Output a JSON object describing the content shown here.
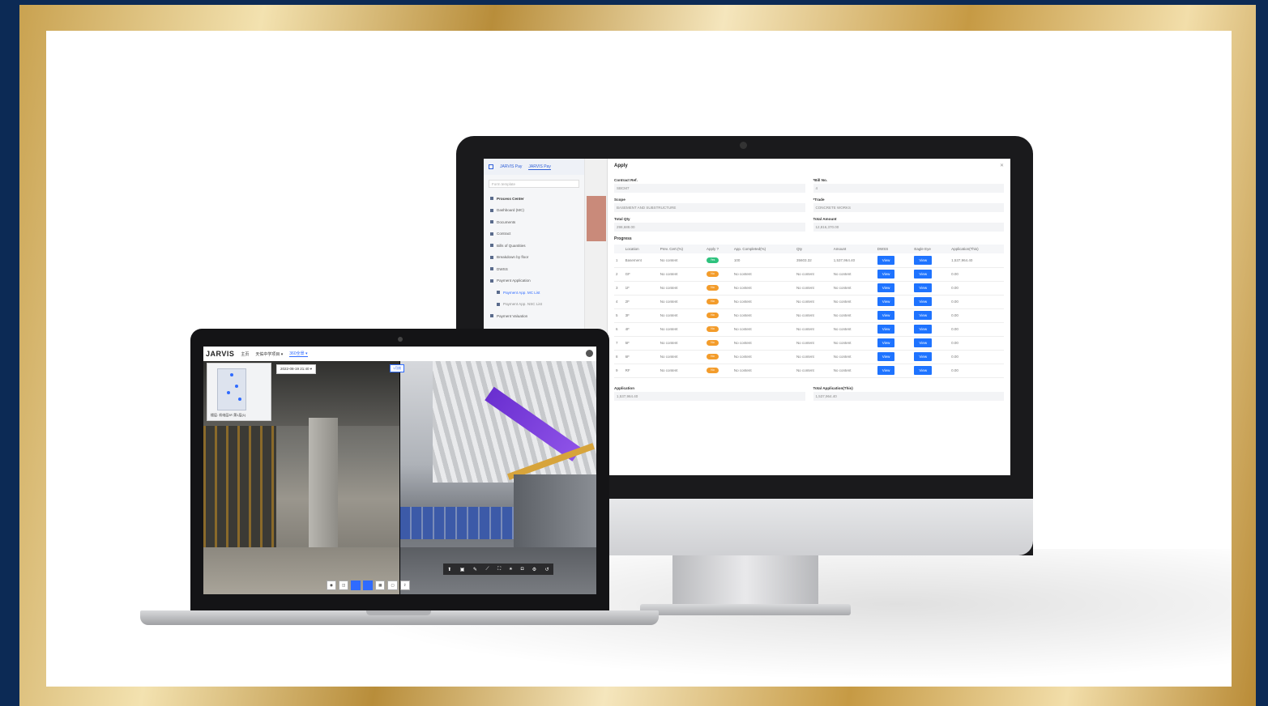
{
  "desktop": {
    "tabs": [
      "JARVIS Pay",
      "JARVIS Pay"
    ],
    "search_placeholder": "Form template",
    "sidebar": [
      {
        "label": "Process Center",
        "kind": "header"
      },
      {
        "label": "Dashboard (MC)",
        "kind": "item"
      },
      {
        "label": "Documents",
        "kind": "item"
      },
      {
        "label": "Contract",
        "kind": "item"
      },
      {
        "label": "Bills of Quantities",
        "kind": "item"
      },
      {
        "label": "Breakdown by floor",
        "kind": "item"
      },
      {
        "label": "DWSS",
        "kind": "item"
      },
      {
        "label": "Payment Application",
        "kind": "item"
      },
      {
        "label": "Payment App. MC List",
        "kind": "sub-selected"
      },
      {
        "label": "Payment App. NSC List",
        "kind": "sub"
      },
      {
        "label": "Payment Valuation",
        "kind": "item"
      }
    ],
    "form": {
      "title": "Apply",
      "contract_ref_label": "Contract Ref.",
      "contract_ref_value": "SBCM7",
      "bill_no_label": "*Bill No.",
      "bill_no_value": "4",
      "scope_label": "Scope",
      "scope_value": "BASEMENT AND SUBSTRUCTURE",
      "trade_label": "*Trade",
      "trade_value": "CONCRETE WORKS",
      "total_qty_label": "Total Qty",
      "total_qty_value": "298,688.00",
      "total_amount_label": "Total Amount",
      "total_amount_value": "12,816,370.00",
      "progress_label": "Progress",
      "columns": [
        "",
        "Location",
        "Prev. Cert.(%)",
        "Apply ?",
        "App. Completed(%)",
        "Qty",
        "Amount",
        "DWSS",
        "Eagle Eye",
        "Application(This)"
      ],
      "rows": [
        {
          "no": "1",
          "location": "Basement",
          "prev": "No content",
          "apply": "Yes",
          "completed": "100",
          "qty": "35603.32",
          "amount": "1,537,964.40",
          "dwss": "View",
          "eagle": "View",
          "app": "1,537,964.40"
        },
        {
          "no": "2",
          "location": "GF",
          "prev": "No content",
          "apply": "No",
          "completed": "No content",
          "qty": "No content",
          "amount": "No content",
          "dwss": "View",
          "eagle": "View",
          "app": "0.00"
        },
        {
          "no": "3",
          "location": "1F",
          "prev": "No content",
          "apply": "No",
          "completed": "No content",
          "qty": "No content",
          "amount": "No content",
          "dwss": "View",
          "eagle": "View",
          "app": "0.00"
        },
        {
          "no": "4",
          "location": "2F",
          "prev": "No content",
          "apply": "No",
          "completed": "No content",
          "qty": "No content",
          "amount": "No content",
          "dwss": "View",
          "eagle": "View",
          "app": "0.00"
        },
        {
          "no": "5",
          "location": "3F",
          "prev": "No content",
          "apply": "No",
          "completed": "No content",
          "qty": "No content",
          "amount": "No content",
          "dwss": "View",
          "eagle": "View",
          "app": "0.00"
        },
        {
          "no": "6",
          "location": "4F",
          "prev": "No content",
          "apply": "No",
          "completed": "No content",
          "qty": "No content",
          "amount": "No content",
          "dwss": "View",
          "eagle": "View",
          "app": "0.00"
        },
        {
          "no": "7",
          "location": "5F",
          "prev": "No content",
          "apply": "No",
          "completed": "No content",
          "qty": "No content",
          "amount": "No content",
          "dwss": "View",
          "eagle": "View",
          "app": "0.00"
        },
        {
          "no": "8",
          "location": "6F",
          "prev": "No content",
          "apply": "No",
          "completed": "No content",
          "qty": "No content",
          "amount": "No content",
          "dwss": "View",
          "eagle": "View",
          "app": "0.00"
        },
        {
          "no": "9",
          "location": "RF",
          "prev": "No content",
          "apply": "No",
          "completed": "No content",
          "qty": "No content",
          "amount": "No content",
          "dwss": "View",
          "eagle": "View",
          "app": "0.00"
        }
      ],
      "application_label": "Application",
      "application_value": "1,537,964.40",
      "total_application_label": "Total Application(This)",
      "total_application_value": "1,537,964.40"
    }
  },
  "laptop": {
    "logo": "JARVIS",
    "tabs": [
      "主页",
      "天佑中学项目 ▾",
      "360全景 ▾"
    ],
    "date": "2022-08-19 21:40 ▾",
    "label_chip": "1月前",
    "map_caption": "楼层: 机电层3F-第1层(1)"
  }
}
